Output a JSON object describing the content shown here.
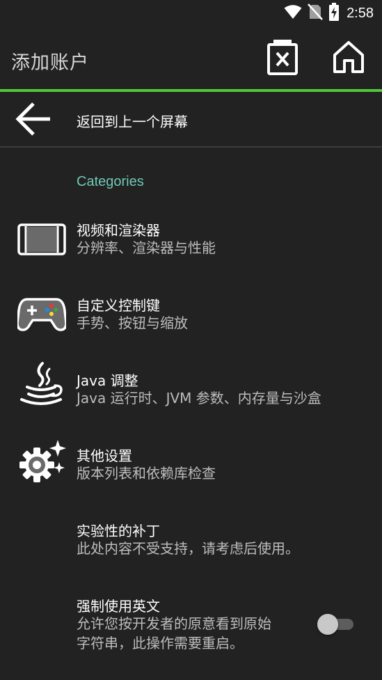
{
  "status_bar": {
    "time": "2:58",
    "icons": [
      "wifi-icon",
      "no-sim-icon",
      "battery-charging-icon"
    ]
  },
  "toolbar": {
    "title": "添加账户",
    "delete_icon": "delete-box-icon",
    "home_icon": "home-icon"
  },
  "colors": {
    "background": "#222222",
    "accent": "#4fc83a",
    "category": "#6ec9b4",
    "summary": "#bdbdbd"
  },
  "back": {
    "label": "返回到上一个屏幕",
    "icon": "arrow-left-icon"
  },
  "categories": {
    "header": "Categories",
    "items": [
      {
        "title": "视频和渲染器",
        "summary": "分辨率、渲染器与性能",
        "icon": "display-icon"
      },
      {
        "title": "自定义控制键",
        "summary": "手势、按钮与缩放",
        "icon": "gamepad-icon"
      },
      {
        "title": "Java 调整",
        "summary": "Java 运行时、JVM 参数、内存量与沙盒",
        "icon": "java-icon"
      },
      {
        "title": "其他设置",
        "summary": "版本列表和依赖库检查",
        "icon": "gear-sparkle-icon"
      },
      {
        "title": "实验性的补丁",
        "summary": "此处内容不受支持，请考虑后使用。",
        "icon": ""
      },
      {
        "title": "强制使用英文",
        "summary_line1": "允许您按开发者的原意看到原始",
        "summary_line2": "字符串，此操作需要重启。",
        "toggle_on": false
      }
    ]
  }
}
